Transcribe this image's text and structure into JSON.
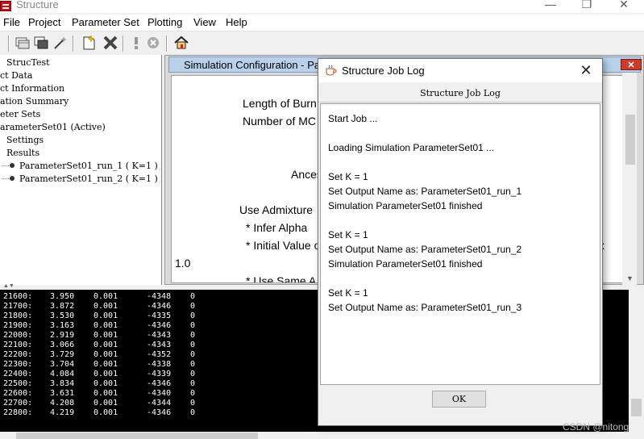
{
  "window": {
    "title": "Structure",
    "controls": {
      "minimize": "—",
      "maximize": "❐",
      "close": "✕"
    }
  },
  "menu": [
    "File",
    "Project",
    "Parameter Set",
    "Plotting",
    "View",
    "Help"
  ],
  "toolbar": {
    "icons": [
      "grid-icon",
      "windows-icon",
      "wand-icon",
      "new-file-icon",
      "delete-icon",
      "run-icon",
      "stop-icon",
      "home-icon"
    ]
  },
  "tree": {
    "rows": [
      "StrucTest",
      "ct Data",
      "ct Information",
      "ation Summary",
      "eter Sets",
      "arameterSet01 (Active)",
      "Settings",
      "Results",
      "ParameterSet01_run_1 ( K=1 )",
      "ParameterSet01_run_2 ( K=1 )"
    ]
  },
  "config": {
    "title": "Simulation Configuration - Pa",
    "close_label": "✕",
    "lines": [
      "Length of Burn",
      "Number of MC",
      "Ances",
      "Use Admixture",
      "* Infer Alpha",
      "* Initial Value o",
      "1.0",
      "* Use Same A"
    ],
    "right_fragment": "):"
  },
  "console": {
    "rows": [
      [
        "21600:",
        "3.950",
        "0.001",
        "-4348",
        "0"
      ],
      [
        "21700:",
        "3.872",
        "0.001",
        "-4346",
        "0"
      ],
      [
        "21800:",
        "3.530",
        "0.001",
        "-4335",
        "0"
      ],
      [
        "21900:",
        "3.163",
        "0.001",
        "-4346",
        "0"
      ],
      [
        "22000:",
        "2.919",
        "0.001",
        "-4343",
        "0"
      ],
      [
        "22100:",
        "3.066",
        "0.001",
        "-4343",
        "0"
      ],
      [
        "22200:",
        "3.729",
        "0.001",
        "-4352",
        "0"
      ],
      [
        "22300:",
        "3.704",
        "0.001",
        "-4338",
        "0"
      ],
      [
        "22400:",
        "4.084",
        "0.001",
        "-4339",
        "0"
      ],
      [
        "22500:",
        "3.834",
        "0.001",
        "-4346",
        "0"
      ],
      [
        "22600:",
        "3.631",
        "0.001",
        "-4340",
        "0"
      ],
      [
        "22700:",
        "4.208",
        "0.001",
        "-4344",
        "0"
      ],
      [
        "22800:",
        "4.219",
        "0.001",
        "-4346",
        "0"
      ]
    ]
  },
  "dialog": {
    "title": "Structure Job Log",
    "header": "Structure Job Log",
    "close_label": "✕",
    "log": [
      "Start Job ...",
      "",
      "Loading Simulation ParameterSet01 ...",
      "",
      "Set K = 1",
      "Set Output Name as: ParameterSet01_run_1",
      "Simulation ParameterSet01 finished",
      "",
      "Set K = 1",
      "Set Output Name as: ParameterSet01_run_2",
      "Simulation ParameterSet01 finished",
      "",
      "Set K = 1",
      "Set Output Name as: ParameterSet01_run_3"
    ],
    "ok_label": "OK"
  },
  "watermark": "CSDN @nitong",
  "colors": {
    "panel_header": "#b9d1ea",
    "close_red": "#c93b2b",
    "console_bg": "#000000",
    "console_fg": "#ffffff"
  }
}
